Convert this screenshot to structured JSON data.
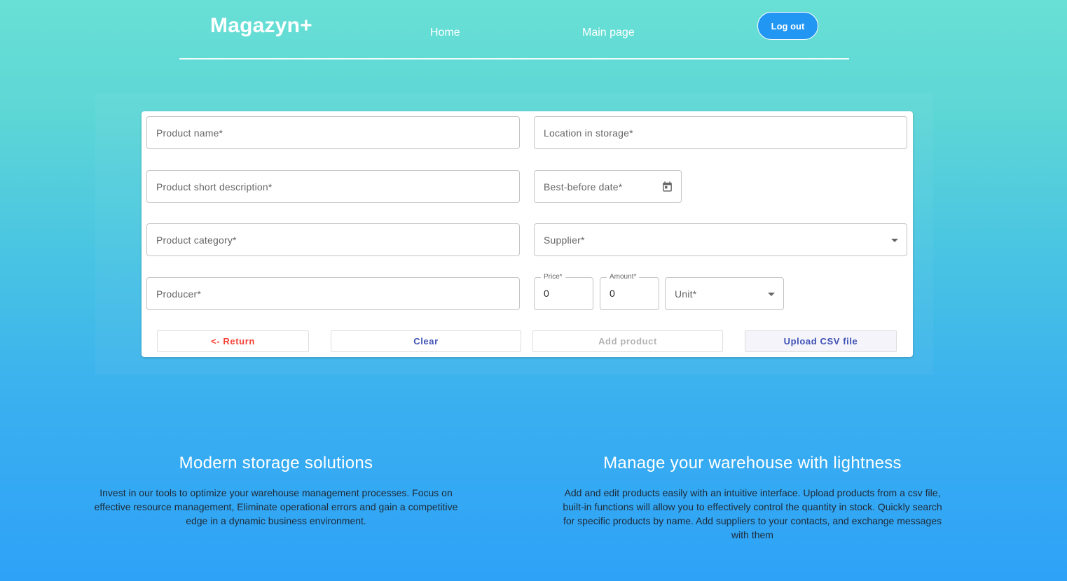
{
  "header": {
    "logo": "Magazyn+",
    "nav": {
      "home": "Home",
      "main": "Main page"
    },
    "logout": "Log out"
  },
  "form": {
    "product_name": "Product name*",
    "location": "Location in storage*",
    "short_description": "Product short description*",
    "best_before": "Best-before date*",
    "category": "Product category*",
    "supplier": "Supplier*",
    "producer": "Producer*",
    "price_label": "Price*",
    "price_value": "0",
    "amount_label": "Amount*",
    "amount_value": "0",
    "unit": "Unit*",
    "buttons": {
      "return": "<- Return",
      "clear": "Clear",
      "add": "Add product",
      "upload": "Upload CSV file"
    }
  },
  "info": {
    "left": {
      "title": "Modern storage solutions",
      "text": "Invest in our tools to optimize your warehouse management processes. Focus on effective resource management, Eliminate operational errors and gain a competitive edge in a dynamic business environment."
    },
    "right": {
      "title": "Manage your warehouse with lightness",
      "text": "Add and edit products easily with an intuitive interface. Upload products from a csv file, built-in functions will allow you to effectively control the quantity in stock. Quickly search for specific products by name. Add suppliers to your contacts, and exchange messages with them"
    }
  },
  "colors": {
    "accent": "#2196f3",
    "return": "#f44336",
    "primary": "#3f51b5"
  },
  "icons": {
    "date": "calendar-icon",
    "dropdown": "chevron-down-icon"
  }
}
